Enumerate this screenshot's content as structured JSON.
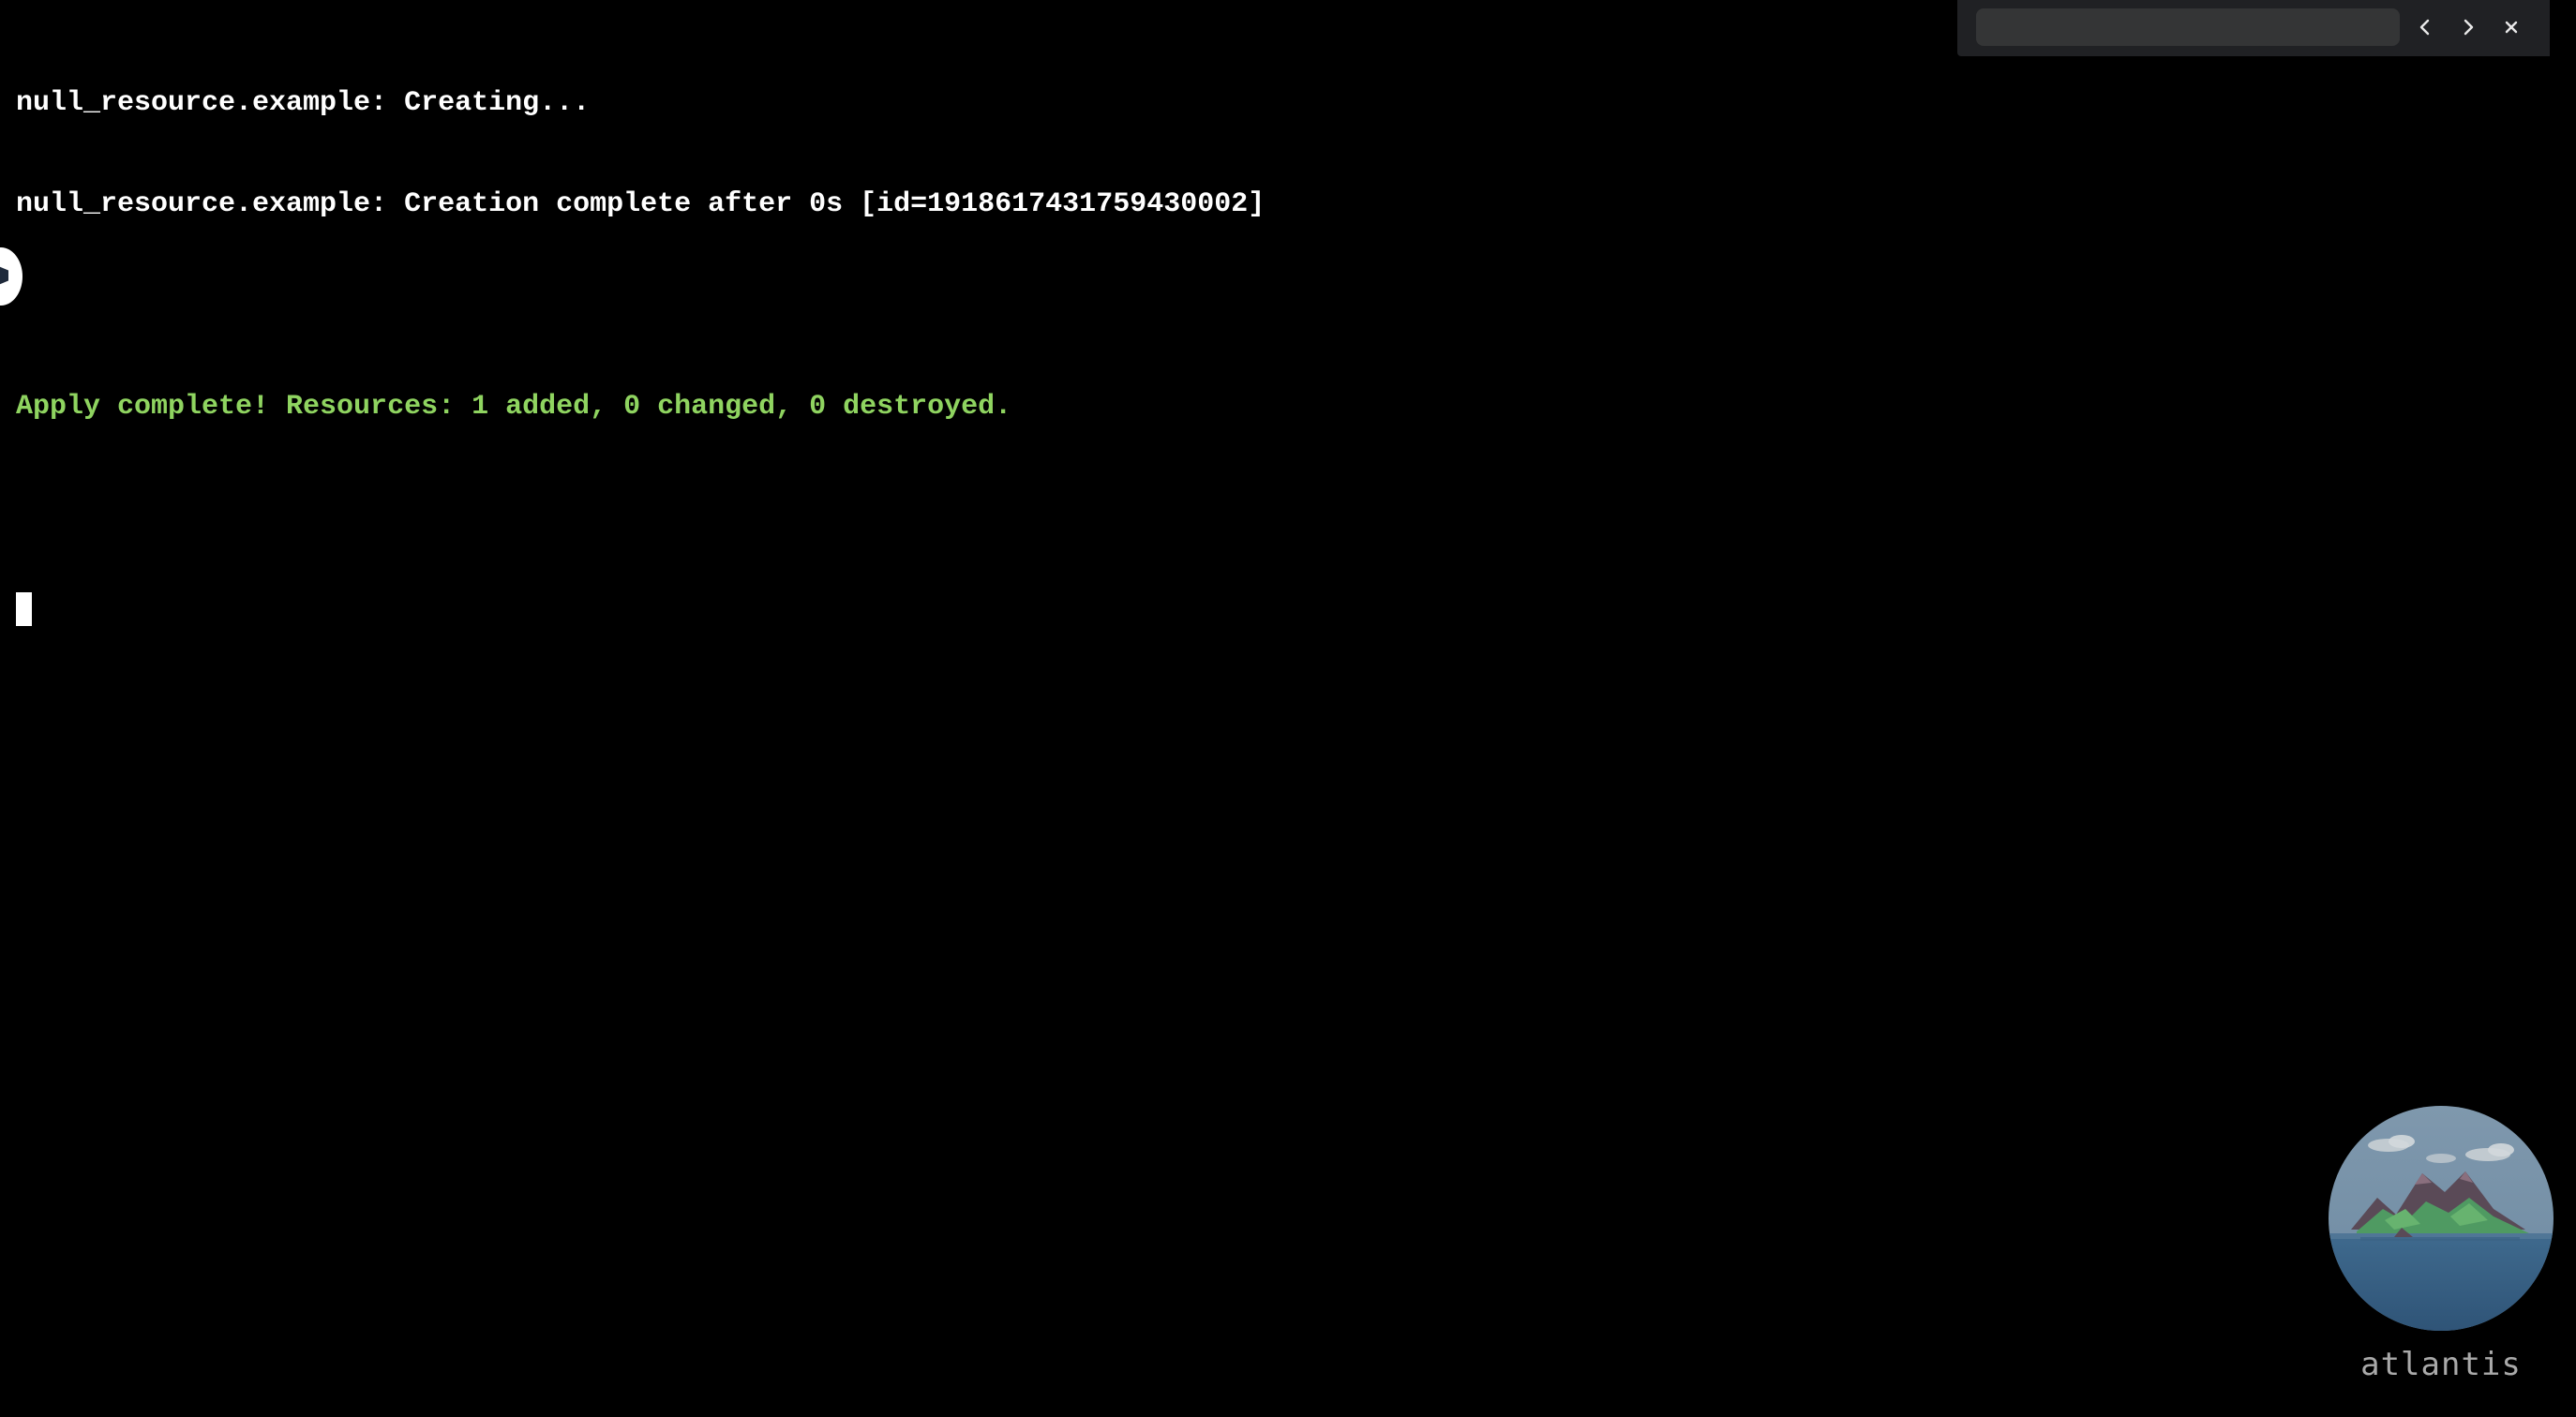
{
  "terminal": {
    "lines": [
      "null_resource.example: Creating...",
      "null_resource.example: Creation complete after 0s [id=1918617431759430002]",
      "",
      "Apply complete! Resources: 1 added, 0 changed, 0 destroyed."
    ],
    "text_color": "#ffffff",
    "success_color": "#8fd460",
    "background": "#000000"
  },
  "find_bar": {
    "search_value": "",
    "icons": {
      "prev": "chevron-left-icon",
      "next": "chevron-right-icon",
      "close": "close-icon"
    }
  },
  "side_handle": {
    "icon": "expand-handle-icon"
  },
  "workspace": {
    "avatar_icon": "island-avatar-icon",
    "label": "atlantis"
  }
}
